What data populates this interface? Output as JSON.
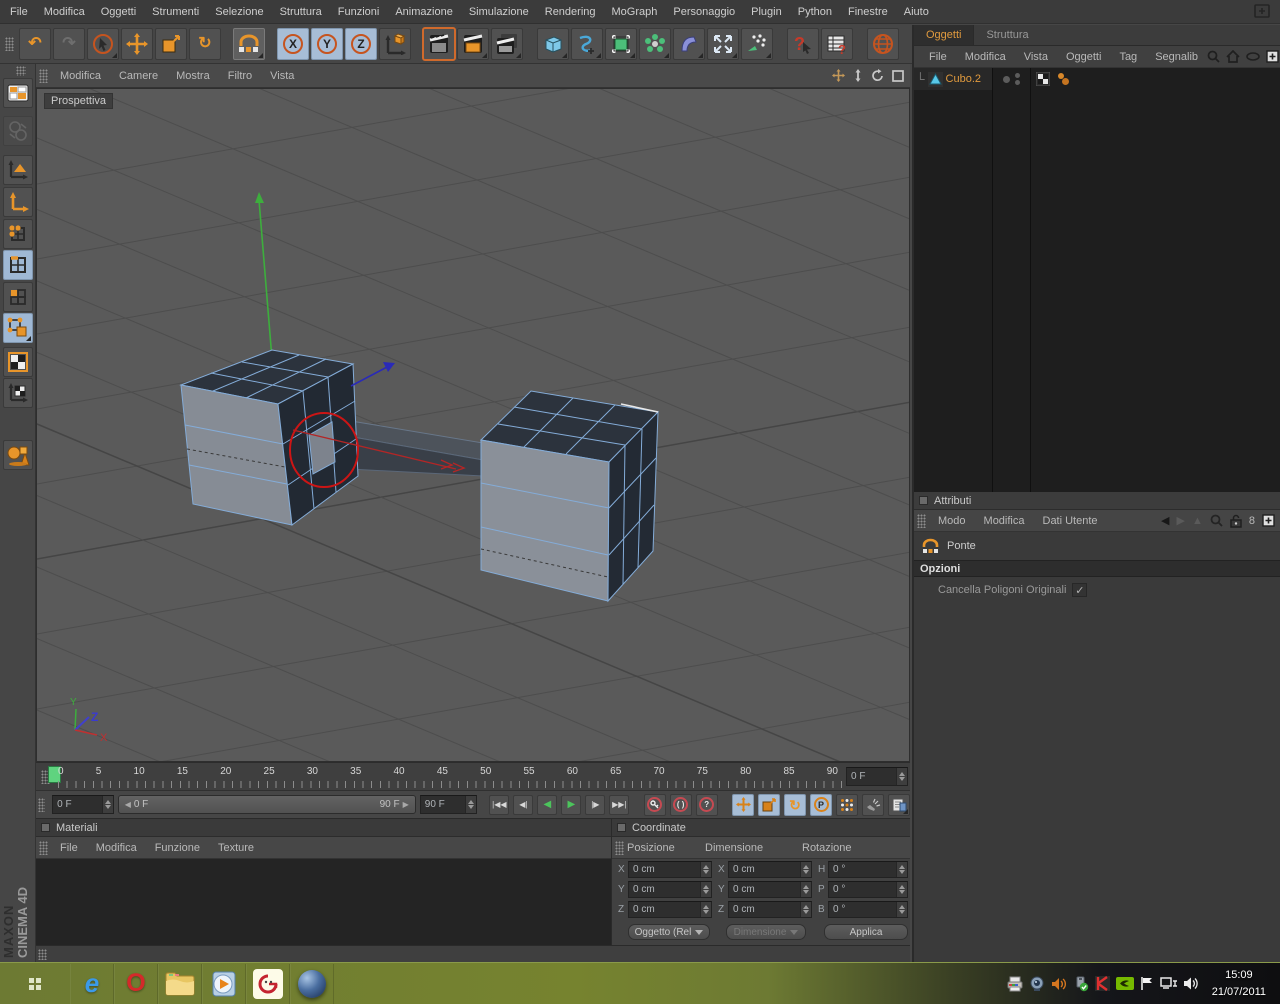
{
  "colors": {
    "accent_orange": "#e8952a",
    "selection_orange": "#e09a3e",
    "highlight_blue": "#a7bdd6",
    "play_green": "#4cc45c",
    "record_red": "#c64a52",
    "viewport_bg": "#5a5a5a",
    "taskbar_olive": "#717e33"
  },
  "menu_bar": {
    "items": [
      "File",
      "Modifica",
      "Oggetti",
      "Strumenti",
      "Selezione",
      "Struttura",
      "Funzioni",
      "Animazione",
      "Simulazione",
      "Rendering",
      "MoGraph",
      "Personaggio",
      "Plugin",
      "Python",
      "Finestre",
      "Aiuto"
    ]
  },
  "toolbar": {
    "axis_x": "X",
    "axis_y": "Y",
    "axis_z": "Z"
  },
  "viewport": {
    "menu_items": [
      "Modifica",
      "Camere",
      "Mostra",
      "Filtro",
      "Vista"
    ],
    "label": "Prospettiva",
    "axis_x": "X",
    "axis_y": "Y",
    "axis_z": "Z"
  },
  "object_manager": {
    "tab_objects": "Oggetti",
    "tab_structure": "Struttura",
    "menu_items": [
      "File",
      "Modifica",
      "Vista",
      "Oggetti",
      "Tag",
      "Segnalib"
    ],
    "object_name": "Cubo.2"
  },
  "attribute_manager": {
    "title": "Attributi",
    "menu_items": [
      "Modo",
      "Modifica",
      "Dati Utente"
    ],
    "tool_name": "Ponte",
    "section_title": "Opzioni",
    "option_label": "Cancella Poligoni Originali",
    "option_checked": true
  },
  "timeline": {
    "ticks": [
      "0",
      "5",
      "10",
      "15",
      "20",
      "25",
      "30",
      "35",
      "40",
      "45",
      "50",
      "55",
      "60",
      "65",
      "70",
      "75",
      "80",
      "85",
      "90"
    ],
    "current_frame": "0 F",
    "range_start": "0 F",
    "range_end": "90 F",
    "end_frame": "90 F"
  },
  "materials_panel": {
    "title": "Materiali",
    "menu_items": [
      "File",
      "Modifica",
      "Funzione",
      "Texture"
    ]
  },
  "coordinates_panel": {
    "title": "Coordinate",
    "col_position": "Posizione",
    "col_size": "Dimensione",
    "col_rotation": "Rotazione",
    "position_rows": [
      {
        "label": "X",
        "value": "0 cm"
      },
      {
        "label": "Y",
        "value": "0 cm"
      },
      {
        "label": "Z",
        "value": "0 cm"
      }
    ],
    "size_rows": [
      {
        "label": "X",
        "value": "0 cm"
      },
      {
        "label": "Y",
        "value": "0 cm"
      },
      {
        "label": "Z",
        "value": "0 cm"
      }
    ],
    "rotation_rows": [
      {
        "label": "H",
        "value": "0 °"
      },
      {
        "label": "P",
        "value": "0 °"
      },
      {
        "label": "B",
        "value": "0 °"
      }
    ],
    "mode_dropdown": "Oggetto (Rel",
    "size_dropdown": "Dimensione",
    "apply_button": "Applica"
  },
  "branding": {
    "maxon": "MAXON",
    "product": "CINEMA 4D"
  },
  "taskbar": {
    "time": "15:09",
    "date": "21/07/2011"
  },
  "icons": {
    "undo": "↶",
    "redo": "↷",
    "rotate": "↻",
    "question": "?",
    "goto_start": "|◀◀",
    "prev_frame": "◀|",
    "play_reverse": "◀",
    "play": "▶",
    "next_frame": "|▶",
    "goto_end": "▶▶|",
    "p_letter": "P",
    "check": "✓",
    "history_back": "◀",
    "history_fwd": "▶",
    "history_up": "▲",
    "dots8": "8",
    "x_glyph": "X",
    "y_glyph": "Y",
    "z_glyph": "Z"
  }
}
